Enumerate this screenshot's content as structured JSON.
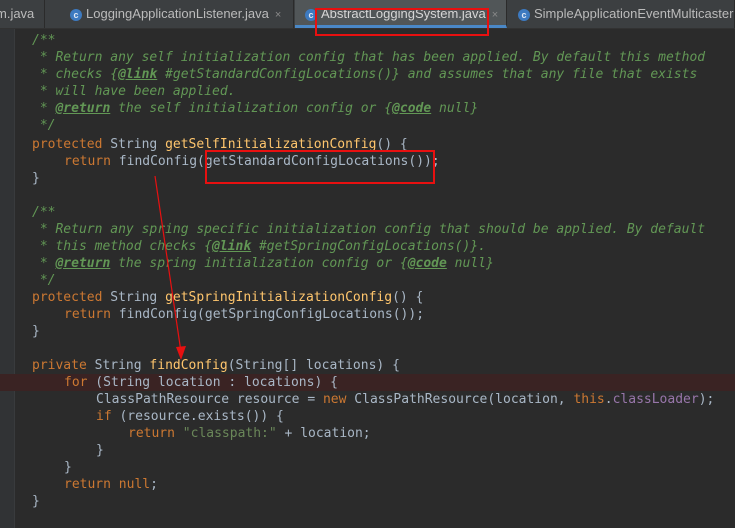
{
  "tabs": [
    {
      "label": "m.java",
      "icon": "class-icon",
      "active": false
    },
    {
      "label": "LoggingApplicationListener.java",
      "icon": "class-icon",
      "active": false
    },
    {
      "label": "AbstractLoggingSystem.java",
      "icon": "class-icon",
      "active": true
    },
    {
      "label": "SimpleApplicationEventMulticaster",
      "icon": "class-icon",
      "active": false
    }
  ],
  "close_glyph": "×",
  "class_icon_glyph": "c",
  "code": {
    "doc1": {
      "l1": "/**",
      "l2": " * Return any self initialization config that has been applied. By default this method",
      "l3a": " * checks {",
      "l3tag": "@link",
      "l3b": " #getStandardConfigLocations()} and assumes that any file that exists",
      "l4": " * will have been applied.",
      "l5a": " * ",
      "l5tag": "@return",
      "l5b": " the self initialization config or {",
      "l5tag2": "@code",
      "l5c": " null}",
      "l6": " */"
    },
    "m1": {
      "mod": "protected",
      "type": " String ",
      "name": "getSelfInitializationConfig",
      "sig": "() {",
      "ret": "return",
      "body": " findConfig(getStandardConfigLocations());",
      "close": "}"
    },
    "doc2": {
      "l1": "/**",
      "l2": " * Return any spring specific initialization config that should be applied. By default",
      "l3a": " * this method checks {",
      "l3tag": "@link",
      "l3b": " #getSpringConfigLocations()}.",
      "l4a": " * ",
      "l4tag": "@return",
      "l4b": " the spring initialization config or {",
      "l4tag2": "@code",
      "l4c": " null}",
      "l5": " */"
    },
    "m2": {
      "mod": "protected",
      "type": " String ",
      "name": "getSpringInitializationConfig",
      "sig": "() {",
      "ret": "return",
      "body": " findConfig(getSpringConfigLocations());",
      "close": "}"
    },
    "m3": {
      "mod": "private",
      "type": " String ",
      "name": "findConfig",
      "sig": "(String[] locations) {",
      "for_kw": "for",
      "for_body": " (String location : locations) {",
      "decl": "ClassPathResource resource = ",
      "new_kw": "new",
      "decl2": " ClassPathResource(location, ",
      "this_kw": "this",
      "dot": ".",
      "field": "classLoader",
      "decl3": ");",
      "if_kw": "if",
      "if_body": " (resource.exists()) {",
      "ret_kw": "return",
      "str": " \"classpath:\"",
      "ret_body": " + location;",
      "close_if": "}",
      "close_for": "}",
      "ret2_kw": "return",
      "null_kw": " null",
      "semi": ";",
      "close": "}"
    }
  }
}
